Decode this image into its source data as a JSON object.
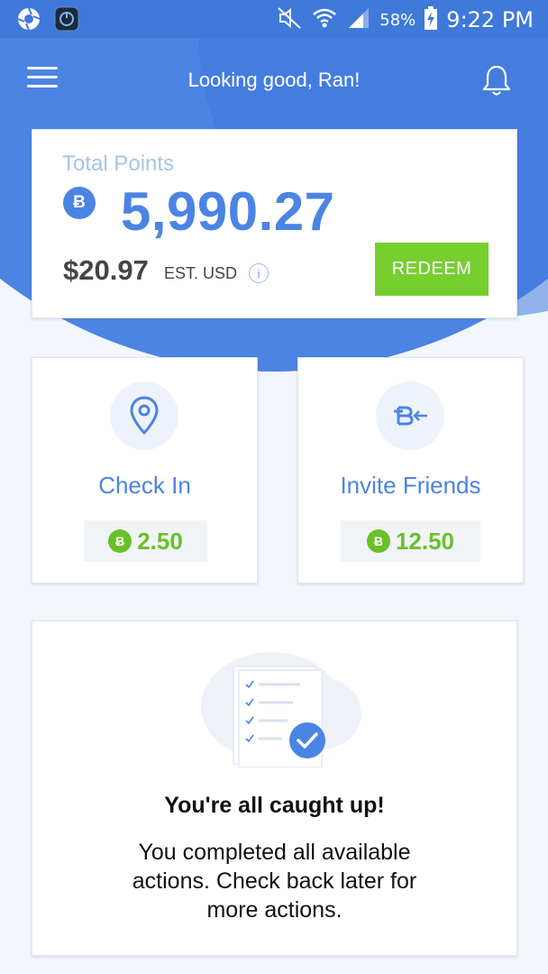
{
  "status_bar": {
    "battery_percent": "58%",
    "time": "9:22 PM",
    "icons": [
      "camera-shutter-icon",
      "app-icon",
      "mute-icon",
      "wifi-icon",
      "signal-icon",
      "battery-charging-icon"
    ]
  },
  "header": {
    "greeting": "Looking good, Ran!",
    "menu_icon": "hamburger-menu-icon",
    "notification_icon": "bell-icon"
  },
  "points_card": {
    "label": "Total Points",
    "coin_symbol": "Ƀ",
    "points": "5,990.27",
    "usd_value": "$20.97",
    "usd_label": "EST. USD",
    "info_symbol": "i",
    "redeem_label": "REDEEM"
  },
  "actions": [
    {
      "title": "Check In",
      "reward": "2.50",
      "icon": "location-pin-icon"
    },
    {
      "title": "Invite Friends",
      "reward": "12.50",
      "icon": "invite-coin-icon"
    }
  ],
  "caught_up": {
    "title": "You're all caught up!",
    "body": "You completed all available actions. Check back later for more actions.",
    "illustration": "checklist-illustration"
  },
  "colors": {
    "primary_blue": "#4b84e3",
    "status_bar_blue": "#3f79d9",
    "redeem_green": "#76cf2f",
    "reward_green": "#6ac02a",
    "background": "#f3f6fb"
  }
}
